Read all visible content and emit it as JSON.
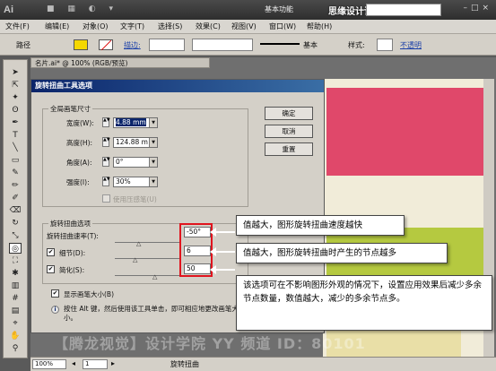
{
  "app": {
    "logo_text": "Ai",
    "workspace": "基本功能",
    "site_watermark": "思缘设计论坛",
    "window_controls": "–□×"
  },
  "menubar": {
    "items": [
      "文件(F)",
      "编辑(E)",
      "对象(O)",
      "文字(T)",
      "选择(S)",
      "效果(C)",
      "视图(V)",
      "窗口(W)",
      "帮助(H)"
    ]
  },
  "control_bar": {
    "selection_label": "路径",
    "stroke_label": "描边:",
    "stroke_style": "基本",
    "style_label": "样式:",
    "opacity_label": "不透明"
  },
  "document": {
    "tab_title": "名片.ai* @ 100% (RGB/预览)"
  },
  "dialog": {
    "title": "旋转扭曲工具选项",
    "global_brush": {
      "legend": "全局画笔尺寸",
      "width_label": "宽度(W):",
      "width_value": "4.88 mm",
      "height_label": "高度(H):",
      "height_value": "124.88 m",
      "angle_label": "角度(A):",
      "angle_value": "0°",
      "intensity_label": "强度(I):",
      "intensity_value": "30%",
      "pressure_label": "使用压感笔(U)"
    },
    "twirl_options": {
      "legend": "旋转扭曲选项",
      "rate_label": "旋转扭曲速率(T):",
      "rate_value": "-50°",
      "detail_label": "细节(D):",
      "detail_value": "6",
      "simplify_label": "简化(S):",
      "simplify_value": "50"
    },
    "show_brush_label": "显示画笔大小(B)",
    "tip": "按住 Alt 键，然后使用该工具单击，即可相应地更改画笔大小。",
    "buttons": {
      "ok": "确定",
      "cancel": "取消",
      "reset": "重置"
    }
  },
  "annotations": {
    "callout_rate": "值越大，图形旋转扭曲速度越快",
    "callout_detail": "值越大，图形旋转扭曲时产生的节点越多",
    "callout_simplify": "该选项可在不影响图形外观的情况下，设置应用效果后减少多余节点数量，数值越大，减少的多余节点多。"
  },
  "status_bar": {
    "zoom": "100%",
    "artboard": "1",
    "tool_name": "旋转扭曲"
  },
  "watermark_bottom": "【腾龙视觉】设计学院 YY 频道 ID：80101",
  "colors": {
    "fill_swatch": "#f5d800",
    "pink_block": "#e0486a",
    "green_block": "#b5c940",
    "highlight_frame": "#e0141e",
    "dialog_title": "#0a246a"
  }
}
